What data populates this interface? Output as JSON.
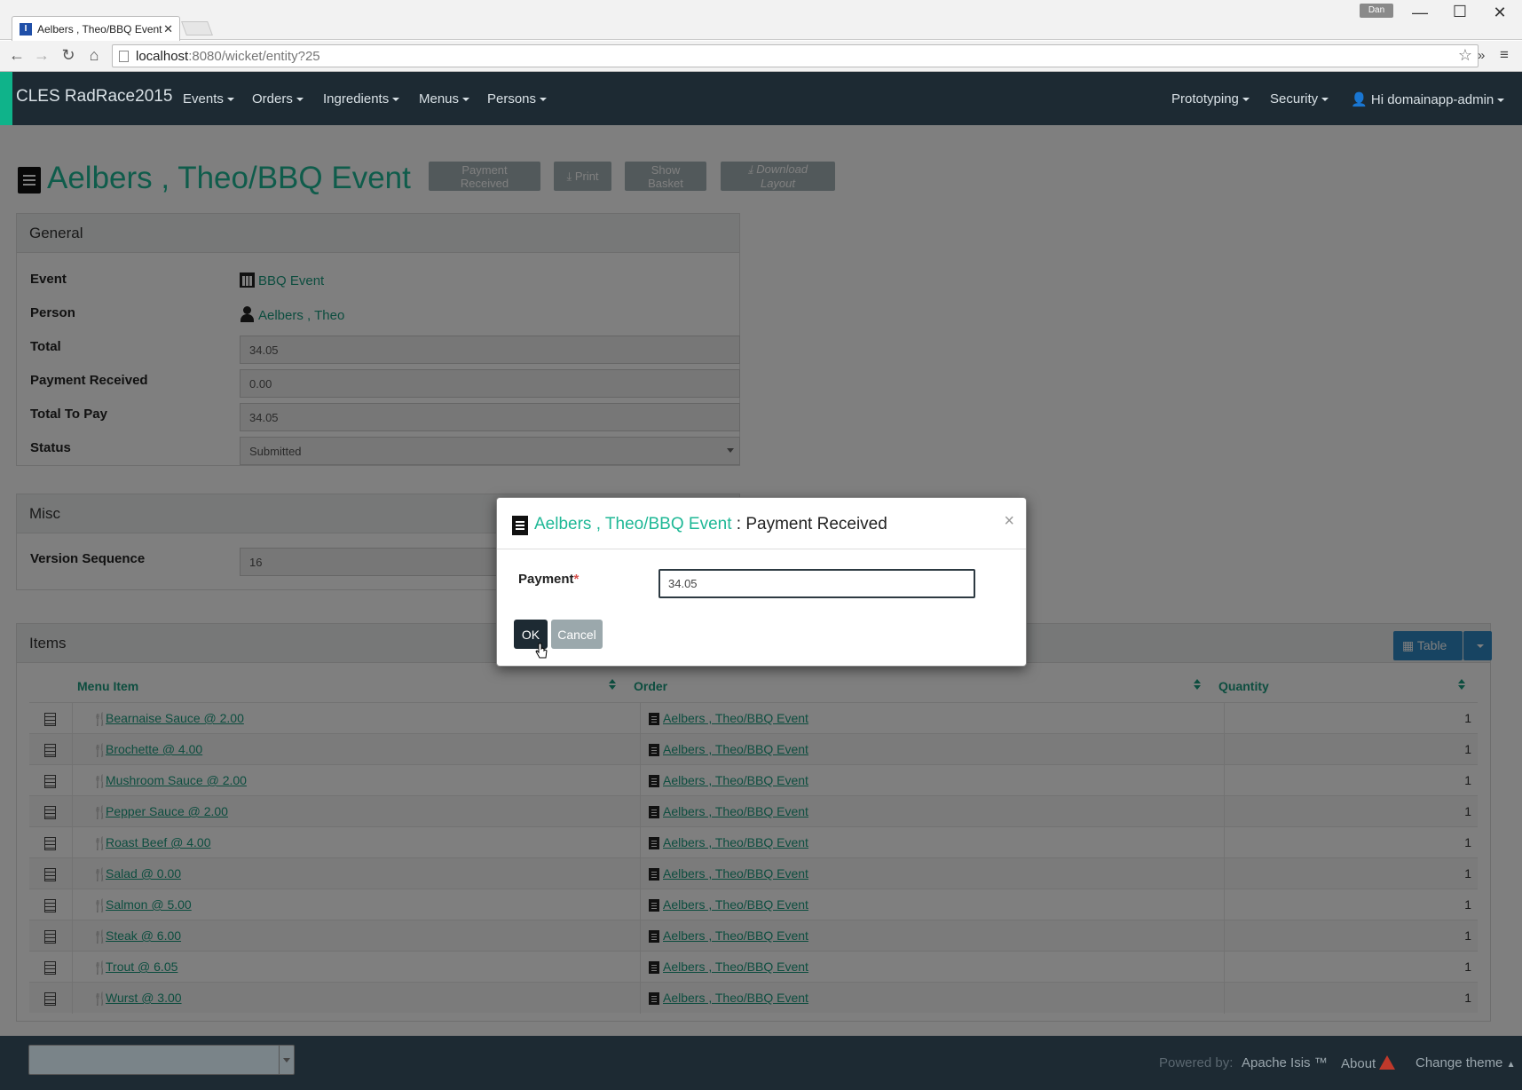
{
  "browser": {
    "tab_title": "Aelbers , Theo/BBQ Event",
    "tab_icon": "I",
    "user": "Dan",
    "url_host": "localhost",
    "url_path": ":8080/wicket/entity?25"
  },
  "navbar": {
    "brand": "CLES RadRace2015",
    "items": [
      "Events",
      "Orders",
      "Ingredients",
      "Menus",
      "Persons"
    ],
    "right_items": [
      "Prototyping",
      "Security",
      "Hi domainapp-admin"
    ]
  },
  "page": {
    "title": "Aelbers , Theo/BBQ Event",
    "actions": {
      "payment_received": "Payment Received",
      "print": "Print",
      "show_basket": "Show Basket",
      "download_layout": "Download Layout"
    }
  },
  "general": {
    "heading": "General",
    "event_label": "Event",
    "event_value": "BBQ Event",
    "person_label": "Person",
    "person_value": "Aelbers , Theo",
    "total_label": "Total",
    "total_value": "34.05",
    "payment_label": "Payment Received",
    "payment_value": "0.00",
    "total_to_pay_label": "Total To Pay",
    "total_to_pay_value": "34.05",
    "status_label": "Status",
    "status_value": "Submitted"
  },
  "misc": {
    "heading": "Misc",
    "version_label": "Version Sequence",
    "version_value": "16"
  },
  "items": {
    "heading": "Items",
    "view_button": "Table",
    "columns": [
      "Menu Item",
      "Order",
      "Quantity"
    ],
    "rows": [
      {
        "menu_item": "Bearnaise Sauce @ 2.00",
        "order": "Aelbers , Theo/BBQ Event",
        "quantity": "1"
      },
      {
        "menu_item": "Brochette @ 4.00",
        "order": "Aelbers , Theo/BBQ Event",
        "quantity": "1"
      },
      {
        "menu_item": "Mushroom Sauce @ 2.00",
        "order": "Aelbers , Theo/BBQ Event",
        "quantity": "1"
      },
      {
        "menu_item": "Pepper Sauce @ 2.00",
        "order": "Aelbers , Theo/BBQ Event",
        "quantity": "1"
      },
      {
        "menu_item": "Roast Beef @ 4.00",
        "order": "Aelbers , Theo/BBQ Event",
        "quantity": "1"
      },
      {
        "menu_item": "Salad @ 0.00",
        "order": "Aelbers , Theo/BBQ Event",
        "quantity": "1"
      },
      {
        "menu_item": "Salmon @ 5.00",
        "order": "Aelbers , Theo/BBQ Event",
        "quantity": "1"
      },
      {
        "menu_item": "Steak @ 6.00",
        "order": "Aelbers , Theo/BBQ Event",
        "quantity": "1"
      },
      {
        "menu_item": "Trout @ 6.05",
        "order": "Aelbers , Theo/BBQ Event",
        "quantity": "1"
      },
      {
        "menu_item": "Wurst @ 3.00",
        "order": "Aelbers , Theo/BBQ Event",
        "quantity": "1"
      }
    ]
  },
  "footer": {
    "powered_by": "Powered by:",
    "apache_isis": "Apache Isis ™",
    "about": "About",
    "change_theme": "Change theme"
  },
  "modal": {
    "object_title": "Aelbers , Theo/BBQ Event",
    "action_title": " : Payment Received",
    "payment_label": "Payment",
    "required_marker": "*",
    "payment_value": "34.05",
    "ok": "OK",
    "cancel": "Cancel"
  },
  "colors": {
    "navbar": "#1d2a33",
    "accent": "#1fb896",
    "link": "#1a9b7f"
  }
}
